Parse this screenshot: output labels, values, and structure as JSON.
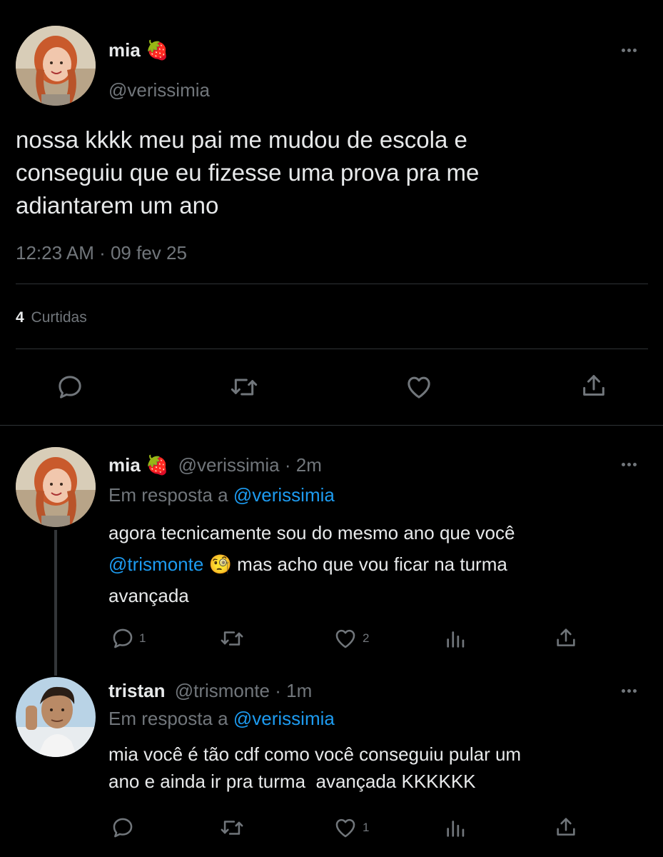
{
  "main_tweet": {
    "display_name": "mia",
    "name_emoji": "🍓",
    "handle": "@verissimia",
    "text_lines": [
      "nossa kkkk meu pai me mudou de escola e",
      "conseguiu que eu fizesse uma prova pra me",
      "adiantarem um ano"
    ],
    "time": "12:23 AM · 09 fev 25",
    "likes_count": "4",
    "likes_label": "Curtidas"
  },
  "replies": [
    {
      "display_name": "mia",
      "name_emoji": "🍓",
      "handle": "@verissimia",
      "age": "· 2m",
      "replying_prefix": "Em resposta a",
      "replying_to": "@verissimia",
      "line1": "agora tecnicamente sou do mesmo ano que você",
      "mention": "@trismonte",
      "emoji": "🧐",
      "line2_rest": "mas acho que vou ficar na turma",
      "line3": "avançada",
      "reply_count": "1",
      "like_count": "2"
    },
    {
      "display_name": "tristan",
      "handle": "@trismonte",
      "age": "· 1m",
      "replying_prefix": "Em resposta a",
      "replying_to": "@verissimia",
      "line1": "mia você é tão cdf como você conseguiu pular um",
      "line2": "ano e ainda ir pra turma  avançada KKKKKK",
      "like_count": "1"
    }
  ],
  "colors": {
    "background": "#000000",
    "text": "#e7e9ea",
    "muted": "#71767b",
    "link": "#1d9bf0",
    "divider": "#2f3336"
  }
}
